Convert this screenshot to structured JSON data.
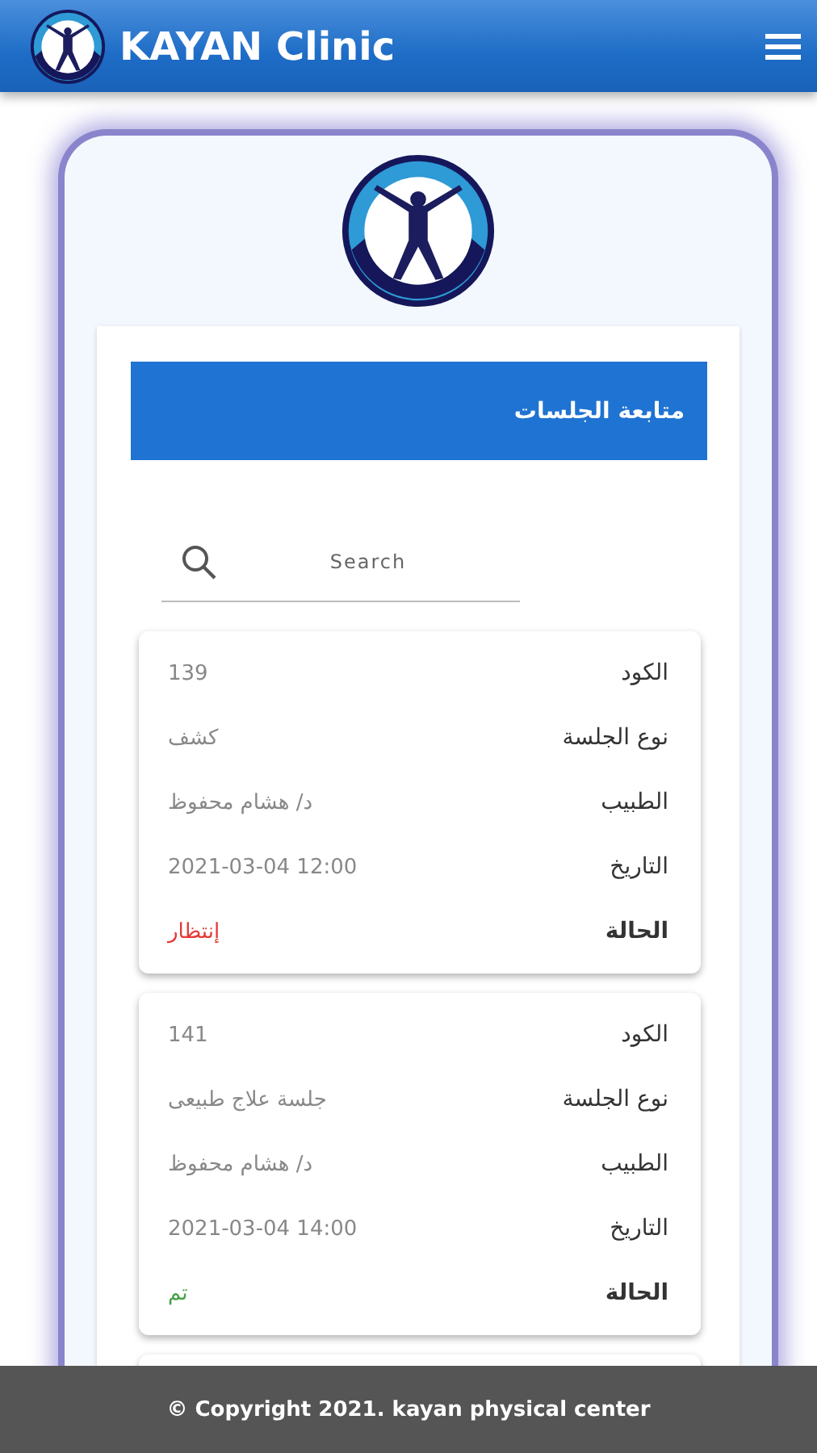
{
  "header": {
    "title": "KAYAN Clinic"
  },
  "page": {
    "heading": "متابعة الجلسات",
    "search": {
      "placeholder": "Search"
    }
  },
  "sessions": [
    {
      "fields": [
        {
          "label": "الكود",
          "value": "139"
        },
        {
          "label": "نوع الجلسة",
          "value": "كشف"
        },
        {
          "label": "الطبيب",
          "value": "د/ هشام محفوظ"
        },
        {
          "label": "التاريخ",
          "value": "2021-03-04 12:00"
        }
      ],
      "status": {
        "label": "الحالة",
        "value": "إنتظار",
        "color": "#e53935"
      }
    },
    {
      "fields": [
        {
          "label": "الكود",
          "value": "141"
        },
        {
          "label": "نوع الجلسة",
          "value": "جلسة علاج طبيعى"
        },
        {
          "label": "الطبيب",
          "value": "د/ هشام محفوظ"
        },
        {
          "label": "التاريخ",
          "value": "2021-03-04 14:00"
        }
      ],
      "status": {
        "label": "الحالة",
        "value": "تم",
        "color": "#43a047"
      }
    }
  ],
  "footer": {
    "text": "© Copyright 2021. kayan physical center"
  }
}
